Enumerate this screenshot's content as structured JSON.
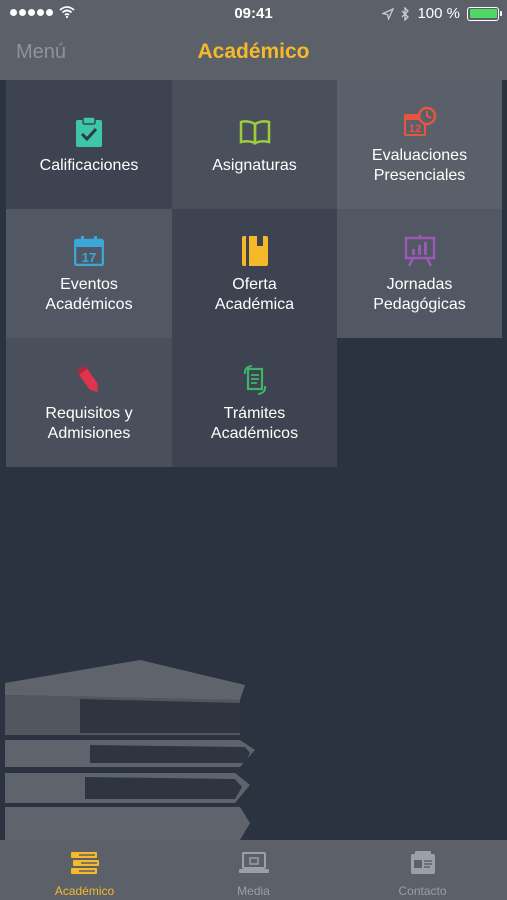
{
  "status": {
    "time": "09:41",
    "battery": "100 %",
    "battery_level": 1.0,
    "signal_bars": 5
  },
  "nav": {
    "menu_label": "Menú",
    "title": "Académico"
  },
  "tiles": [
    {
      "label": "Calificaciones",
      "icon": "clipboard-check-icon",
      "color": "#3ec6a8"
    },
    {
      "label": "Asignaturas",
      "icon": "open-book-icon",
      "color": "#9ccc3c"
    },
    {
      "label": "Evaluaciones\nPresenciales",
      "icon": "calendar-clock-icon",
      "color": "#e8553e"
    },
    {
      "label": "Eventos\nAcadémicos",
      "icon": "calendar-icon",
      "color": "#3aa7d8",
      "icon_text": "17"
    },
    {
      "label": "Oferta\nAcadémica",
      "icon": "notebook-icon",
      "color": "#f6b92a"
    },
    {
      "label": "Jornadas\nPedagógicas",
      "icon": "presentation-board-icon",
      "color": "#9b59b6"
    },
    {
      "label": "Requisitos y\nAdmisiones",
      "icon": "pencil-icon",
      "color": "#e0344c"
    },
    {
      "label": "Trámites\nAcadémicos",
      "icon": "documents-refresh-icon",
      "color": "#3cb56b"
    }
  ],
  "tabbar": {
    "items": [
      {
        "label": "Académico",
        "icon": "books-icon",
        "active": true
      },
      {
        "label": "Media",
        "icon": "laptop-icon",
        "active": false
      },
      {
        "label": "Contacto",
        "icon": "contact-card-icon",
        "active": false
      }
    ]
  },
  "colors": {
    "accent": "#f6b92a",
    "background": "#2c3340",
    "bar": "#5c6169"
  }
}
